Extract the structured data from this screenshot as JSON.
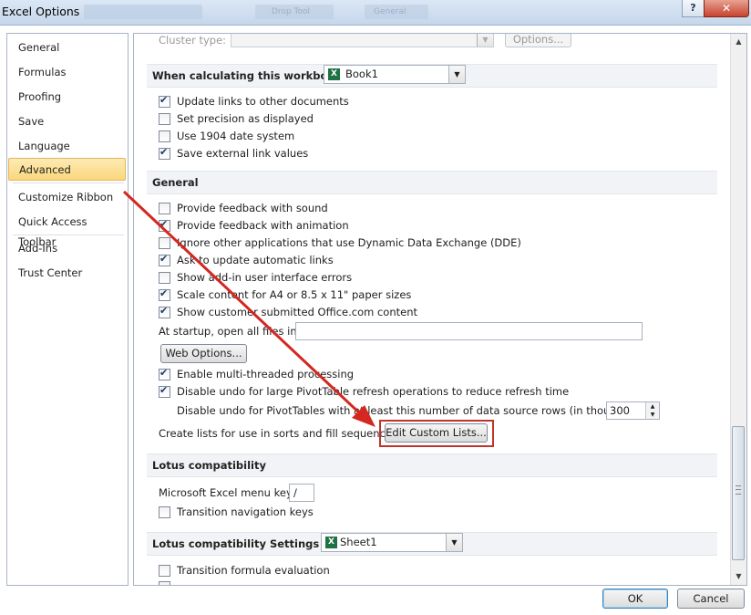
{
  "window": {
    "title": "Excel Options",
    "help_label": "?",
    "close_label": "✕",
    "ghost_label_1": "Drop Tool",
    "ghost_label_2": "General"
  },
  "nav": {
    "items": [
      {
        "label": "General"
      },
      {
        "label": "Formulas"
      },
      {
        "label": "Proofing"
      },
      {
        "label": "Save"
      },
      {
        "label": "Language"
      },
      {
        "label": "Advanced",
        "selected": true
      },
      {
        "label": "Customize Ribbon"
      },
      {
        "label": "Quick Access Toolbar"
      },
      {
        "label": "Add-Ins"
      },
      {
        "label": "Trust Center"
      }
    ]
  },
  "cluster": {
    "label": "Cluster type:",
    "options_button": "Options..."
  },
  "workbook_section": {
    "header": "When calculating this workbook:",
    "selected_workbook": "Book1",
    "options": [
      {
        "label": "Update links to other documents",
        "checked": true
      },
      {
        "label": "Set precision as displayed",
        "checked": false
      },
      {
        "label": "Use 1904 date system",
        "checked": false
      },
      {
        "label": "Save external link values",
        "checked": true
      }
    ]
  },
  "general_section": {
    "header": "General",
    "options": [
      {
        "label": "Provide feedback with sound",
        "checked": false
      },
      {
        "label": "Provide feedback with animation",
        "checked": true
      },
      {
        "label": "Ignore other applications that use Dynamic Data Exchange (DDE)",
        "checked": false
      },
      {
        "label": "Ask to update automatic links",
        "checked": true
      },
      {
        "label": "Show add-in user interface errors",
        "checked": false
      },
      {
        "label": "Scale content for A4 or 8.5 x 11\" paper sizes",
        "checked": true
      },
      {
        "label": "Show customer submitted Office.com content",
        "checked": true
      }
    ],
    "startup_label": "At startup, open all files in:",
    "startup_value": "",
    "web_options_button": "Web Options...",
    "options2": [
      {
        "label": "Enable multi-threaded processing",
        "checked": true
      },
      {
        "label": "Disable undo for large PivotTable refresh operations to reduce refresh time",
        "checked": true
      }
    ],
    "pivot_rows_label": "Disable undo for PivotTables with at least this number of data source rows (in thousands):",
    "pivot_rows_value": "300",
    "custom_lists_label": "Create lists for use in sorts and fill sequences:",
    "custom_lists_button": "Edit Custom Lists..."
  },
  "lotus_section": {
    "header": "Lotus compatibility",
    "menu_key_label": "Microsoft Excel menu key:",
    "menu_key_value": "/",
    "options": [
      {
        "label": "Transition navigation keys",
        "checked": false
      }
    ]
  },
  "lotus_settings_section": {
    "header": "Lotus compatibility Settings for:",
    "selected_sheet": "Sheet1",
    "options": [
      {
        "label": "Transition formula evaluation",
        "checked": false
      }
    ]
  },
  "footer": {
    "ok_label": "OK",
    "cancel_label": "Cancel"
  },
  "colors": {
    "annotation_arrow": "#d4271f",
    "selected_nav": "#fbd77c",
    "excel_green": "#1f7244"
  }
}
